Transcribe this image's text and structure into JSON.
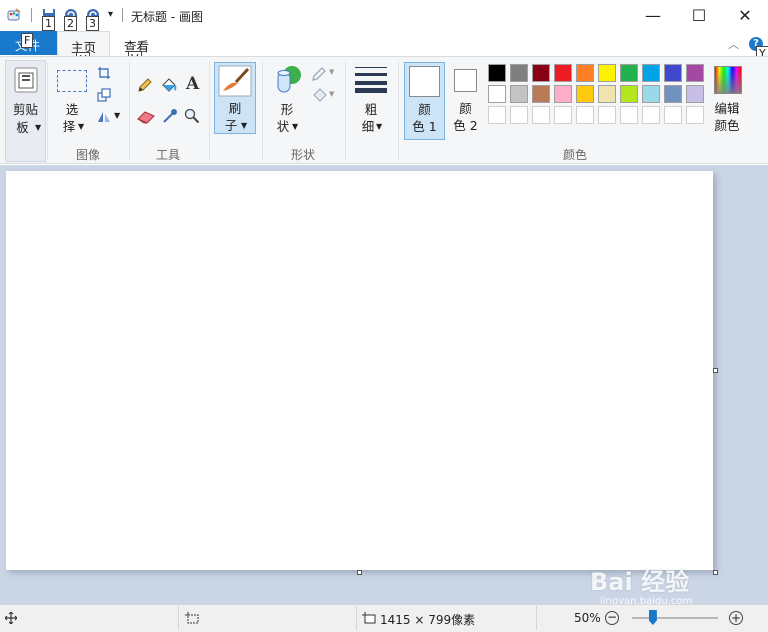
{
  "window": {
    "title": "无标题 - 画图",
    "minimize": "—",
    "maximize": "☐",
    "close": "✕"
  },
  "quick_access": {
    "keytips": [
      "1",
      "2",
      "3"
    ]
  },
  "tabs": {
    "file_label": "文件",
    "file_keytip": "F",
    "home_label": "主页",
    "home_keytip": "H",
    "view_label": "查看",
    "view_keytip": "V",
    "help_keytip": "Y"
  },
  "ribbon": {
    "clipboard": {
      "label_line1": "剪贴",
      "label_line2": "板"
    },
    "image": {
      "select_line1": "选",
      "select_line2": "择",
      "group": "图像"
    },
    "tools": {
      "group": "工具"
    },
    "brushes": {
      "line1": "刷",
      "line2": "子"
    },
    "shapes": {
      "line1": "形",
      "line2": "状",
      "group": "形状"
    },
    "size": {
      "line1": "粗",
      "line2": "细"
    },
    "color1": {
      "line1": "颜",
      "line2": "色 1"
    },
    "color2": {
      "line1": "颜",
      "line2": "色 2"
    },
    "edit_colors": {
      "line1": "编辑",
      "line2": "颜色"
    },
    "colors_group": "颜色",
    "palette_row1": [
      "#000000",
      "#7f7f7f",
      "#880015",
      "#ed1c24",
      "#ff7f27",
      "#fff200",
      "#22b14c",
      "#00a2e8",
      "#3f48cc",
      "#a349a4"
    ],
    "palette_row2": [
      "#ffffff",
      "#c3c3c3",
      "#b97a57",
      "#ffaec9",
      "#ffc90e",
      "#efe4b0",
      "#b5e61d",
      "#99d9ea",
      "#7092be",
      "#c8bfe7"
    ]
  },
  "status": {
    "dimensions": "1415 × 799像素",
    "zoom": "50%",
    "zoom_value_percent": 50
  },
  "watermark": {
    "text": "Bai 经验",
    "url": "jingyan.baidu.com"
  }
}
